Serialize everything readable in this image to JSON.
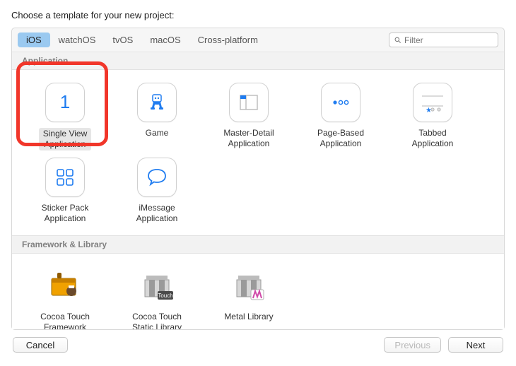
{
  "heading": "Choose a template for your new project:",
  "tabs": [
    "iOS",
    "watchOS",
    "tvOS",
    "macOS",
    "Cross-platform"
  ],
  "selected_tab_index": 0,
  "filter": {
    "placeholder": "Filter"
  },
  "sections": {
    "application": {
      "title": "Application",
      "items": [
        {
          "label": "Single View\nApplication",
          "selected": true
        },
        {
          "label": "Game"
        },
        {
          "label": "Master-Detail\nApplication"
        },
        {
          "label": "Page-Based\nApplication"
        },
        {
          "label": "Tabbed\nApplication"
        },
        {
          "label": "Sticker Pack\nApplication"
        },
        {
          "label": "iMessage\nApplication"
        }
      ]
    },
    "framework": {
      "title": "Framework & Library",
      "items": [
        {
          "label": "Cocoa Touch\nFramework"
        },
        {
          "label": "Cocoa Touch\nStatic Library"
        },
        {
          "label": "Metal Library"
        }
      ]
    }
  },
  "buttons": {
    "cancel": "Cancel",
    "previous": "Previous",
    "next": "Next"
  },
  "colors": {
    "accent": "#1f7cf0",
    "highlight": "#f1362a"
  }
}
